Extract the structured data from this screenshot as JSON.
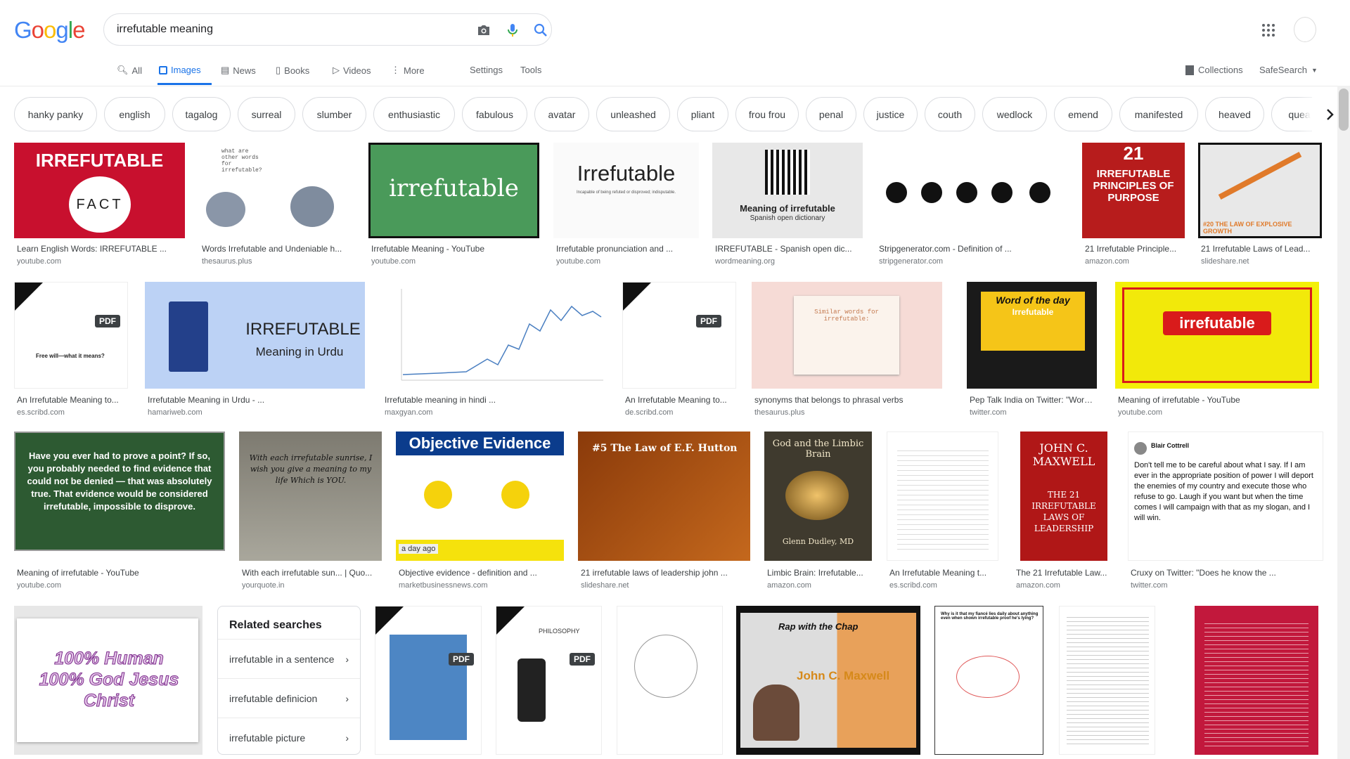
{
  "search": {
    "query": "irrefutable meaning"
  },
  "logo": {
    "text": "Google"
  },
  "tabs": [
    {
      "label": "All"
    },
    {
      "label": "Images"
    },
    {
      "label": "News"
    },
    {
      "label": "Books"
    },
    {
      "label": "Videos"
    },
    {
      "label": "More"
    }
  ],
  "tools": {
    "settings": "Settings",
    "tools": "Tools"
  },
  "header_right": {
    "collections": "Collections",
    "safesearch": "SafeSearch"
  },
  "chips": [
    "hanky panky",
    "english",
    "tagalog",
    "surreal",
    "slumber",
    "enthusiastic",
    "fabulous",
    "avatar",
    "unleashed",
    "pliant",
    "frou frou",
    "penal",
    "justice",
    "couth",
    "wedlock",
    "emend",
    "manifested",
    "heaved",
    "quea"
  ],
  "results": [
    {
      "caption": "Learn English Words: IRREFUTABLE ...",
      "domain": "youtube.com",
      "thumb_text": "IRREFUTABLE",
      "thumb_sub": "FACT"
    },
    {
      "caption": "Words Irrefutable and Undeniable h...",
      "domain": "thesaurus.plus",
      "thumb_text": "what are other words for irrefutable?"
    },
    {
      "caption": "Irrefutable Meaning - YouTube",
      "domain": "youtube.com",
      "thumb_text": "irrefutable"
    },
    {
      "caption": "Irrefutable pronunciation and ...",
      "domain": "youtube.com",
      "thumb_text": "Irrefutable",
      "thumb_sub": "Incapable of being refuted or disproved; indisputable."
    },
    {
      "caption": "IRREFUTABLE - Spanish open dic...",
      "domain": "wordmeaning.org",
      "thumb_text": "Meaning of irrefutable",
      "thumb_sub": "Spanish open dictionary"
    },
    {
      "caption": "Stripgenerator.com - Definition of ...",
      "domain": "stripgenerator.com",
      "thumb_text": ""
    },
    {
      "caption": "21 Irrefutable Principle...",
      "domain": "amazon.com",
      "thumb_text": "IRREFUTABLE PRINCIPLES OF PURPOSE",
      "thumb_sub": "21"
    },
    {
      "caption": "21 Irrefutable Laws of Lead...",
      "domain": "slideshare.net",
      "thumb_text": "#20 THE LAW OF EXPLOSIVE GROWTH"
    },
    {
      "caption": "An Irrefutable Meaning to...",
      "domain": "es.scribd.com",
      "thumb_text": "Free will—what it means?",
      "badge": "PDF"
    },
    {
      "caption": "Irrefutable Meaning in Urdu - ...",
      "domain": "hamariweb.com",
      "thumb_text": "IRREFUTABLE",
      "thumb_sub": "Meaning in Urdu"
    },
    {
      "caption": "Irrefutable meaning in hindi ...",
      "domain": "maxgyan.com",
      "thumb_text": ""
    },
    {
      "caption": "An Irrefutable Meaning to...",
      "domain": "de.scribd.com",
      "thumb_text": "",
      "badge": "PDF"
    },
    {
      "caption": "synonyms that belongs to phrasal verbs",
      "domain": "thesaurus.plus",
      "thumb_text": "Similar words for irrefutable:"
    },
    {
      "caption": "Pep Talk India on Twitter: \"Word...",
      "domain": "twitter.com",
      "thumb_text": "Word of the day",
      "thumb_sub": "Irrefutable"
    },
    {
      "caption": "Meaning of irrefutable - YouTube",
      "domain": "youtube.com",
      "thumb_text": "irrefutable"
    },
    {
      "caption": "Meaning of irrefutable - YouTube",
      "domain": "youtube.com",
      "thumb_text": "Have you ever had to prove a point? If so, you probably needed to find evidence that could not be denied — that was absolutely true. That evidence would be considered irrefutable, impossible to disprove."
    },
    {
      "caption": "With each irrefutable sun... | Quo...",
      "domain": "yourquote.in",
      "thumb_text": "With each irrefutable sunrise, I wish you give a meaning to my life Which is YOU."
    },
    {
      "caption": "Objective evidence - definition and ...",
      "domain": "marketbusinessnews.com",
      "thumb_text": "Objective Evidence",
      "thumb_sub": "a day ago"
    },
    {
      "caption": "21 irrefutable laws of leadership john ...",
      "domain": "slideshare.net",
      "thumb_text": "#5 The Law of E.F. Hutton"
    },
    {
      "caption": "Limbic Brain: Irrefutable...",
      "domain": "amazon.com",
      "thumb_text": "God and the Limbic Brain",
      "thumb_sub": "Glenn Dudley, MD"
    },
    {
      "caption": "An Irrefutable Meaning t...",
      "domain": "es.scribd.com",
      "thumb_text": ""
    },
    {
      "caption": "The 21 Irrefutable Law...",
      "domain": "amazon.com",
      "thumb_text": "JOHN C. MAXWELL",
      "thumb_sub": "THE 21 IRREFUTABLE LAWS OF LEADERSHIP"
    },
    {
      "caption": "Cruxy on Twitter: \"Does he know the ...",
      "domain": "twitter.com",
      "thumb_text": "Don't tell me to be careful about what I say. If I am ever in the appropriate position of power I will deport the enemies of my country and execute those who refuse to go. Laugh if you want but when the time comes I will campaign with that as my slogan, and I will win.",
      "thumb_sub": "Blair Cottrell"
    },
    {
      "caption": "",
      "domain": "",
      "thumb_text": "100% Human 100% God Jesus Christ"
    },
    {
      "caption": "",
      "domain": "",
      "thumb_text": "",
      "badge": "PDF"
    },
    {
      "caption": "",
      "domain": "",
      "thumb_text": "PHILOSOPHY",
      "badge": "PDF"
    },
    {
      "caption": "",
      "domain": "",
      "thumb_text": ""
    },
    {
      "caption": "",
      "domain": "",
      "thumb_text": "Rap with the Chap",
      "thumb_sub": "John C. Maxwell"
    },
    {
      "caption": "",
      "domain": "",
      "thumb_text": "Why is it that my fiancé lies daily about anything even when shown irrefutable proof he's lying?"
    },
    {
      "caption": "",
      "domain": "",
      "thumb_text": ""
    },
    {
      "caption": "",
      "domain": "",
      "thumb_text": ""
    }
  ],
  "related": {
    "title": "Related searches",
    "items": [
      "irrefutable in a sentence",
      "irrefutable definicion",
      "irrefutable picture"
    ]
  },
  "colors": {
    "accent": "#1a73e8",
    "text": "#202124",
    "muted": "#70757a"
  }
}
